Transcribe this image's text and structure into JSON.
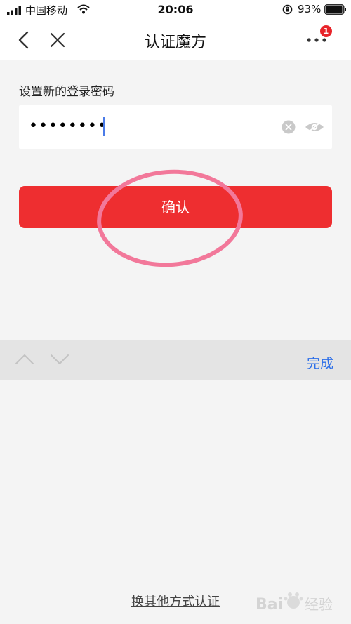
{
  "status_bar": {
    "carrier": "中国移动",
    "time": "20:06",
    "battery": "93%"
  },
  "nav": {
    "title": "认证魔方",
    "badge_count": "1"
  },
  "form": {
    "label": "设置新的登录密码",
    "password_mask": "••••••••"
  },
  "confirm_button": {
    "label": "确认"
  },
  "keyboard_toolbar": {
    "done_label": "完成"
  },
  "footer": {
    "switch_link": "换其他方式认证"
  },
  "watermark": {
    "text": "Bai 经验"
  },
  "colors": {
    "accent_red": "#ee2e30",
    "highlight_pink": "#f2789a",
    "done_blue": "#2d6fe8",
    "badge_red": "#e8242a"
  },
  "icons": [
    "cellular-signal-icon",
    "wifi-icon",
    "rotation-lock-icon",
    "battery-icon",
    "back-arrow-icon",
    "close-icon",
    "more-icon",
    "clear-icon",
    "eye-icon",
    "chevron-up-icon",
    "chevron-down-icon"
  ]
}
